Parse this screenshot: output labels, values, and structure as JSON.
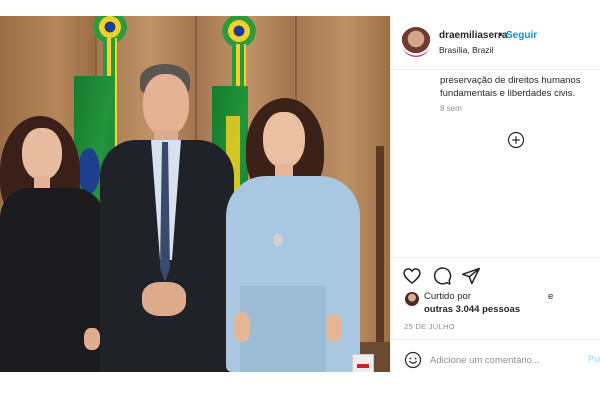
{
  "post": {
    "username": "draemiliaserra",
    "separator": "•",
    "follow_label": "Seguir",
    "location": "Brasília, Brazil",
    "caption_lines": [
      "preservação de direitos humanos",
      "fundamentais e liberdades civis."
    ],
    "time_ago": "8 sem",
    "likes": {
      "liked_by_label": "Curtido por",
      "liked_by_tail": "e",
      "others_label": "outras 3.044 pessoas"
    },
    "date": "25 DE JULHO",
    "comment": {
      "placeholder": "Adicione um comentário...",
      "value": "",
      "publish_label": "Publicar"
    }
  },
  "icons": {
    "like": "heart-icon",
    "comment": "comment-bubble-icon",
    "share": "paper-plane-icon",
    "more_comments": "plus-circle-icon",
    "emoji": "smiley-icon"
  },
  "colors": {
    "link_blue": "#0095f6",
    "text": "#262626",
    "muted": "#8e8e8e",
    "publish_disabled": "#b2dffc",
    "border": "#efefef"
  }
}
